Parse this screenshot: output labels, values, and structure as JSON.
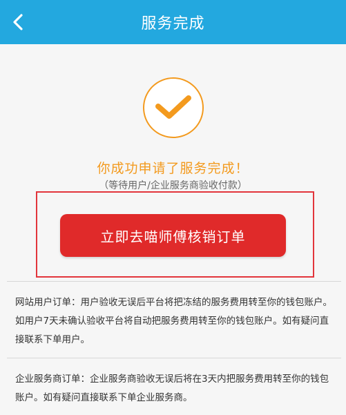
{
  "header": {
    "title": "服务完成",
    "back_icon": "chevron-left-icon",
    "background_color": "#23a8df"
  },
  "status": {
    "icon": "checkmark-circle-icon",
    "accent_color": "#f39a1e",
    "message": "你成功申请了服务完成！",
    "subtitle": "（等待用户/企业服务商验收付款）"
  },
  "action": {
    "button_label": "立即去喵师傅核销订单",
    "button_color": "#e02a2a"
  },
  "notes": [
    {
      "text": "网站用户订单：用户验收无误后平台将把冻结的服务费用转至你的钱包账户。如用户7天未确认验收平台将自动把服务费用转至你的钱包账户。如有疑问直接联系下单用户。"
    },
    {
      "text": "企业服务商订单：企业服务商验收无误后将在3天内把服务费用转至你的钱包账户。如有疑问直接联系下单企业服务商。"
    }
  ]
}
